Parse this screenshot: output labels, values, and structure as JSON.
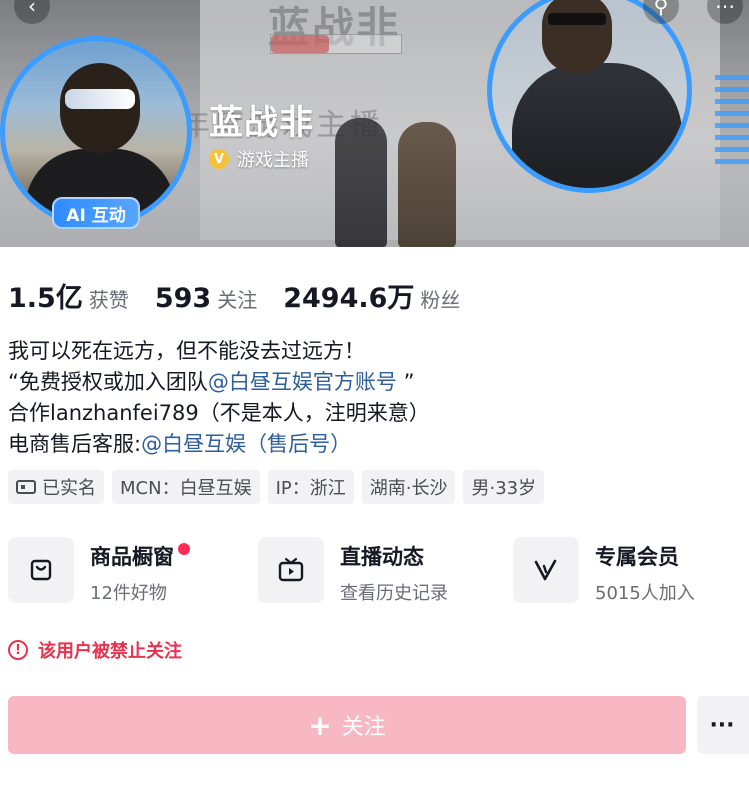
{
  "header": {
    "back_icon": "chevron-left-icon",
    "search_icon": "search-icon",
    "more_icon": "more-icon",
    "avatar_badge": "AI 互动",
    "name": "蓝战非",
    "verify_icon": "verified-v-icon",
    "verify_label": "游戏主播"
  },
  "stats": [
    {
      "value": "1.5亿",
      "label": "获赞"
    },
    {
      "value": "593",
      "label": "关注"
    },
    {
      "value": "2494.6万",
      "label": "粉丝"
    }
  ],
  "bio": {
    "line1": "我可以死在远方，但不能没去过远方！",
    "line2_prefix": "“免费授权或加入团队",
    "line2_mention": "@白昼互娱官方账号",
    "line2_suffix": " ”",
    "line3": "合作lanzhanfei789（不是本人，注明来意）",
    "line4_prefix": "电商售后客服:",
    "line4_mention": "@白昼互娱（售后号）"
  },
  "tags": [
    {
      "label": "已实名",
      "icon": "id-card-icon"
    },
    {
      "label": "MCN：白昼互娱"
    },
    {
      "label": "IP：浙江"
    },
    {
      "label": "湖南·长沙"
    },
    {
      "label": "男·33岁"
    }
  ],
  "features": [
    {
      "title": "商品橱窗",
      "subtitle": "12件好物",
      "icon": "shopping-bag-icon",
      "has_dot": true
    },
    {
      "title": "直播动态",
      "subtitle": "查看历史记录",
      "icon": "tv-play-icon"
    },
    {
      "title": "专属会员",
      "subtitle": "5015人加入",
      "icon": "v-member-icon"
    }
  ],
  "warning": {
    "icon": "exclamation-circle-icon",
    "text": "该用户被禁止关注"
  },
  "actions": {
    "follow_label": "关注",
    "follow_icon": "plus-icon",
    "more_label": "···"
  },
  "colors": {
    "accent_blue": "#3b9cff",
    "warning_red": "#e8334f",
    "follow_disabled": "#f7b7c3",
    "mention_blue": "#2e5e9e"
  }
}
